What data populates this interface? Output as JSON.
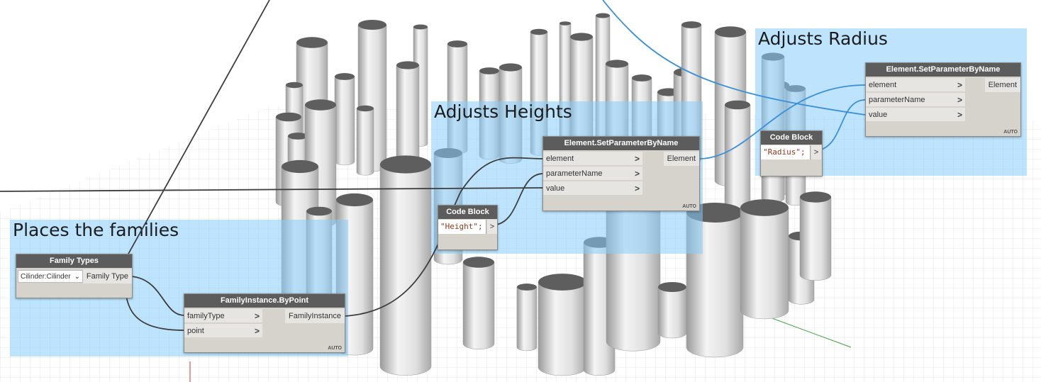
{
  "groups": {
    "radius": {
      "title": "Adjusts Radius"
    },
    "heights": {
      "title": "Adjusts Heights"
    },
    "places": {
      "title": "Places the families"
    }
  },
  "nodes": {
    "set_radius": {
      "header": "Element.SetParameterByName",
      "inputs": [
        "element",
        "parameterName",
        "value"
      ],
      "output": "Element",
      "auto": "AUTO"
    },
    "set_height": {
      "header": "Element.SetParameterByName",
      "inputs": [
        "element",
        "parameterName",
        "value"
      ],
      "output": "Element",
      "auto": "AUTO"
    },
    "code_radius": {
      "header": "Code Block",
      "code": "\"Radius\";",
      "output": ">"
    },
    "code_height": {
      "header": "Code Block",
      "code": "\"Height\";",
      "output": ">"
    },
    "family_types": {
      "header": "Family Types",
      "selected": "Cilinder:Cilinder",
      "chevron": "⌄",
      "output": "Family Type"
    },
    "family_instance": {
      "header": "FamilyInstance.ByPoint",
      "inputs": [
        "familyType",
        "point"
      ],
      "output": "FamilyInstance",
      "auto": "AUTO"
    }
  },
  "colors": {
    "group_fill": "#87cefa",
    "node_header": "#5c5c5c",
    "node_body": "#d6d3cd",
    "wire_dark": "#3d3d3d",
    "wire_blue": "#3a8fd6"
  }
}
